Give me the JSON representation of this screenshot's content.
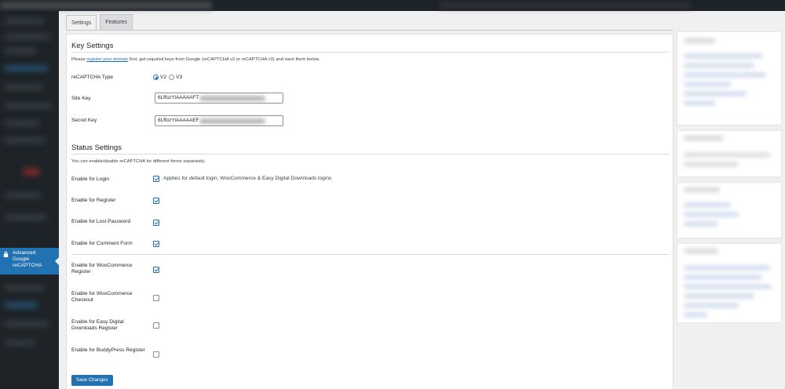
{
  "tabs": [
    {
      "label": "Settings",
      "active": true
    },
    {
      "label": "Features",
      "active": false
    }
  ],
  "sidebar": {
    "active_item": "Advanced Google reCAPTCHA",
    "active_item_lines": [
      "Advanced",
      "Google",
      "reCAPTCHA"
    ],
    "icon": "lock-icon"
  },
  "key_settings": {
    "title": "Key Settings",
    "desc_before": "Please ",
    "desc_link": "register your domain",
    "desc_after": " first, get required keys from Google (reCAPTCHA v2 or reCAPTCHA v3) and save them below.",
    "recaptcha_type_label": "reCAPTCHA Type",
    "options": [
      {
        "label": "V2",
        "checked": true
      },
      {
        "label": "V3",
        "checked": false
      }
    ],
    "site_key_label": "Site Key",
    "site_key_value": "6LffozYlAAAAAFT",
    "secret_key_label": "Secret Key",
    "secret_key_value": "6LffozYlAAAAAEF"
  },
  "status_settings": {
    "title": "Status Settings",
    "desc": "You can enable/disable reCAPTCHA for different forms separately.",
    "items": [
      {
        "label": "Enable for Login",
        "checked": true,
        "note": "Applies for default login, WooCommerce & Easy Digital Downloads logins"
      },
      {
        "label": "Enable for Register",
        "checked": true,
        "note": ""
      },
      {
        "label": "Enable for Lost Password",
        "checked": true,
        "note": ""
      },
      {
        "label": "Enable for Comment Form",
        "checked": true,
        "note": ""
      },
      {
        "label": "Enable for WooCommerce Register",
        "checked": true,
        "note": ""
      },
      {
        "label": "Enable for WooCommerce Checkout",
        "checked": false,
        "note": ""
      },
      {
        "label": "Enable for Easy Digital Downloads Register",
        "checked": false,
        "note": ""
      },
      {
        "label": "Enable for BuddyPress Register",
        "checked": false,
        "note": ""
      }
    ]
  },
  "save_button": "Save Changes",
  "colors": {
    "accent": "#2271b1",
    "sidebar": "#1d2327",
    "background": "#f0f0f1"
  }
}
